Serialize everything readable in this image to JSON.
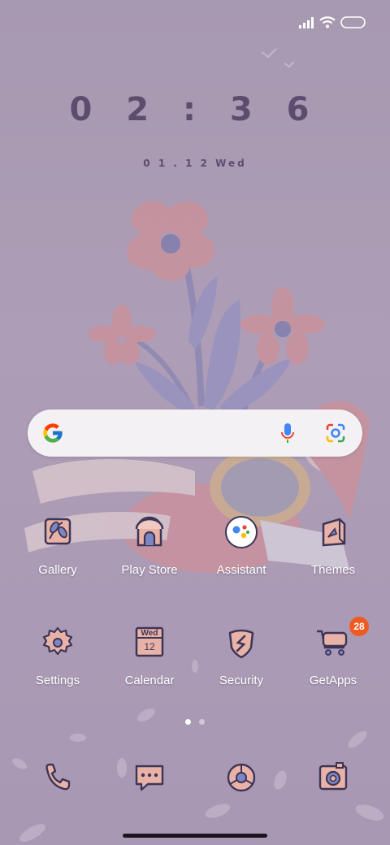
{
  "clock": {
    "time": "0 2 : 3 6",
    "date": "0 1 . 1 2  Wed"
  },
  "search": {
    "logo_icon": "google-g-icon",
    "mic_icon": "mic-icon",
    "lens_icon": "lens-icon"
  },
  "apps_row1": [
    {
      "label": "Gallery",
      "icon": "gallery-icon"
    },
    {
      "label": "Play Store",
      "icon": "play-store-icon"
    },
    {
      "label": "Assistant",
      "icon": "assistant-icon"
    },
    {
      "label": "Themes",
      "icon": "themes-icon"
    }
  ],
  "apps_row2": [
    {
      "label": "Settings",
      "icon": "settings-icon"
    },
    {
      "label": "Calendar",
      "icon": "calendar-icon",
      "day": "Wed",
      "date": "12"
    },
    {
      "label": "Security",
      "icon": "security-icon"
    },
    {
      "label": "GetApps",
      "icon": "getapps-icon",
      "badge": "28"
    }
  ],
  "pager": {
    "current": 1,
    "total": 2
  },
  "dock": [
    {
      "icon": "phone-icon"
    },
    {
      "icon": "messages-icon"
    },
    {
      "icon": "browser-icon"
    },
    {
      "icon": "camera-icon"
    }
  ],
  "colors": {
    "icon_fill": "#e8b2a6",
    "icon_stroke": "#3c3558",
    "badge": "#f05a22"
  }
}
